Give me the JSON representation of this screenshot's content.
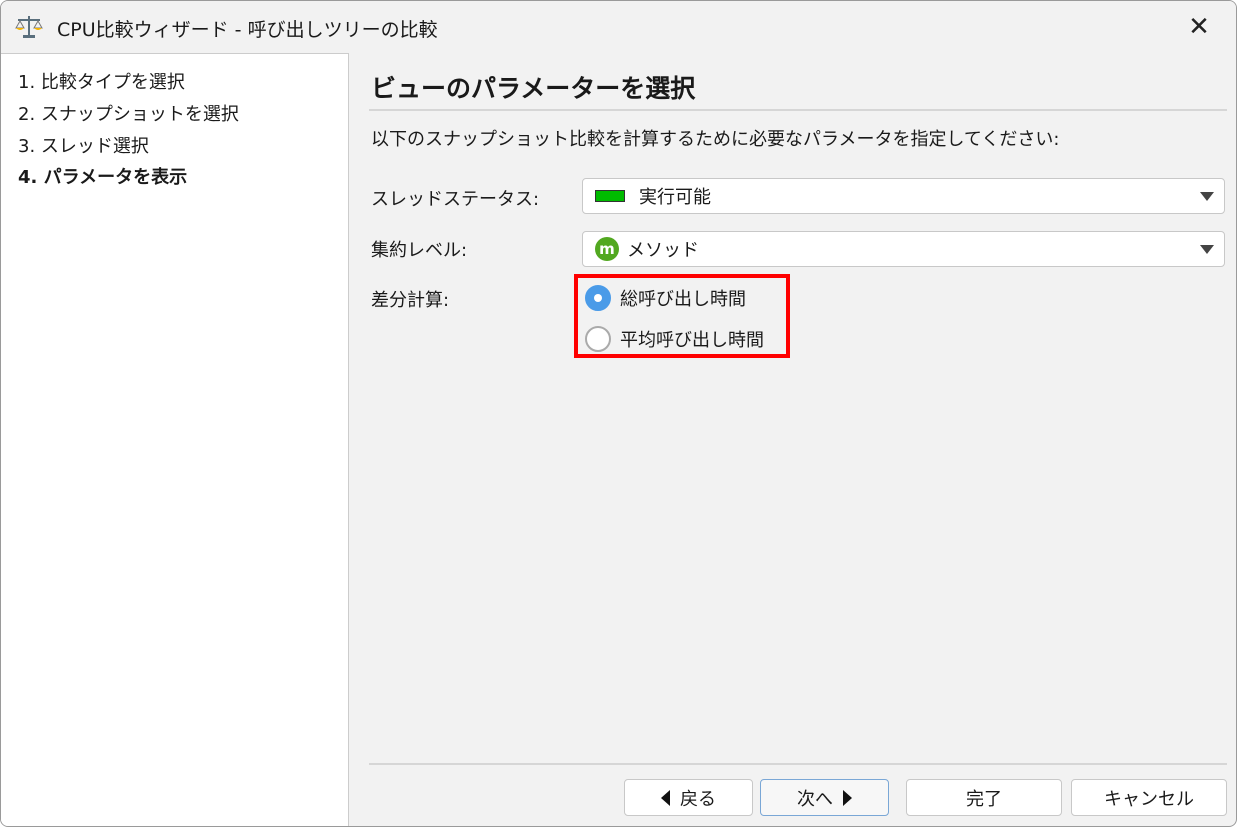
{
  "window": {
    "title": "CPU比較ウィザード - 呼び出しツリーの比較"
  },
  "steps": [
    "1. 比較タイプを選択",
    "2. スナップショットを選択",
    "3. スレッド選択",
    "4. パラメータを表示"
  ],
  "main": {
    "heading": "ビューのパラメーターを選択",
    "description": "以下のスナップショット比較を計算するために必要なパラメータを指定してください:",
    "thread_status": {
      "label": "スレッドステータス:",
      "value": "実行可能",
      "color": "#00bb00"
    },
    "aggregation": {
      "label": "集約レベル:",
      "value": "メソッド",
      "icon_letter": "m"
    },
    "diff": {
      "label": "差分計算:",
      "options": [
        {
          "label": "総呼び出し時間",
          "selected": true
        },
        {
          "label": "平均呼び出し時間",
          "selected": false
        }
      ]
    }
  },
  "buttons": {
    "back": "戻る",
    "next": "次へ",
    "finish": "完了",
    "cancel": "キャンセル"
  }
}
